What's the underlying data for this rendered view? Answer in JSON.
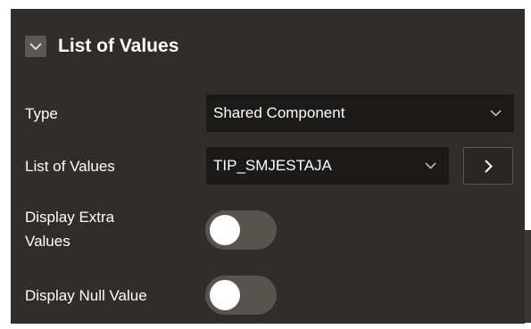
{
  "section": {
    "title": "List of Values"
  },
  "fields": {
    "type": {
      "label": "Type",
      "value": "Shared Component"
    },
    "list_of_values": {
      "label": "List of Values",
      "value": "TIP_SMJESTAJA"
    },
    "display_extra_values": {
      "label_line1": "Display Extra",
      "label_line2": "Values",
      "checked": false
    },
    "display_null_value": {
      "label": "Display Null Value",
      "checked": false
    }
  },
  "icons": {
    "collapse": "chevron-down-icon",
    "select_arrow": "chevron-down-icon",
    "nav": "chevron-right-icon"
  },
  "colors": {
    "panel_bg": "#312d2a",
    "field_bg": "#1c1a18",
    "toggle_off": "#57534f",
    "text": "#ffffff"
  }
}
